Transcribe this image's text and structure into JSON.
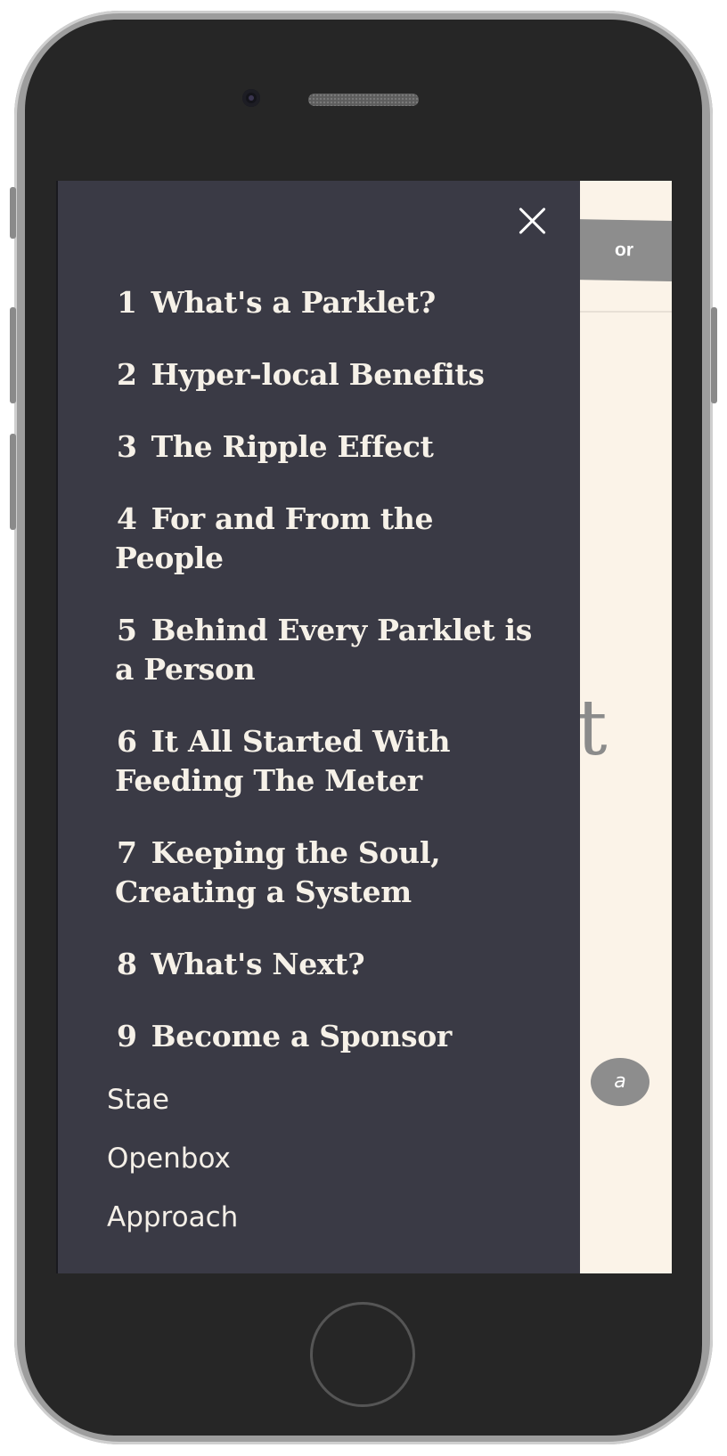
{
  "background": {
    "button_label": "or",
    "title_fragment": "t",
    "badge_glyph": "a"
  },
  "drawer": {
    "toc": [
      {
        "num": "1",
        "label": "What's a Parklet?"
      },
      {
        "num": "2",
        "label": "Hyper-local Benefits"
      },
      {
        "num": "3",
        "label": "The Ripple Effect"
      },
      {
        "num": "4",
        "label": "For and From the People"
      },
      {
        "num": "5",
        "label": "Behind Every Parklet is a Person"
      },
      {
        "num": "6",
        "label": "It All Started With Feeding The Meter"
      },
      {
        "num": "7",
        "label": "Keeping the Soul, Creating a System"
      },
      {
        "num": "8",
        "label": "What's Next?"
      },
      {
        "num": "9",
        "label": "Become a Sponsor"
      }
    ],
    "links": [
      "Stae",
      "Openbox",
      "Approach"
    ]
  },
  "colors": {
    "drawer_bg": "#3a3a45",
    "page_bg": "#fbf3e8",
    "text": "#f6f1e8"
  },
  "icons": {
    "close": "close-icon"
  }
}
